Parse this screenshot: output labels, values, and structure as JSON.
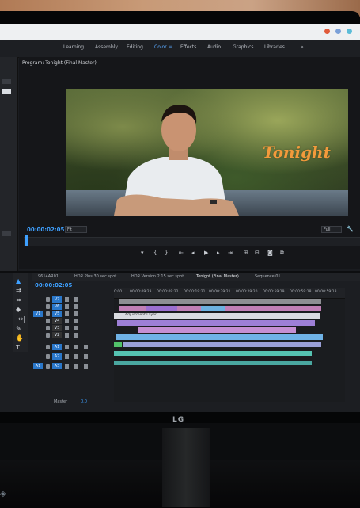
{
  "workspace_tabs": [
    {
      "label": "Learning"
    },
    {
      "label": "Assembly"
    },
    {
      "label": "Editing"
    },
    {
      "label": "Color",
      "active": true
    },
    {
      "label": "Effects"
    },
    {
      "label": "Audio"
    },
    {
      "label": "Graphics"
    },
    {
      "label": "Libraries"
    },
    {
      "label": "»"
    }
  ],
  "program_monitor": {
    "title": "Program: Tonight (Final Master)",
    "overlay_text": "Tonight",
    "timecode": "00:00:02:05",
    "fit_label": "Fit",
    "quality_label": "Full"
  },
  "timeline": {
    "timecode": "00:00:02:05",
    "sequence_tabs": [
      {
        "label": "9614AR01"
      },
      {
        "label": "HDR Plus 30 sec.spot"
      },
      {
        "label": "HDR Version 2 15 sec.spot"
      },
      {
        "label": "Tonight (Final Master)",
        "active": true
      },
      {
        "label": "Sequence 01"
      }
    ],
    "ruler_ticks": [
      "0:00",
      "00:00:09:23",
      "00:00:09:22",
      "00:00:19:21",
      "00:00:39:21",
      "00:00:29:20",
      "00:00:59:19",
      "00:00:59:18",
      "00:00:59:18"
    ],
    "video_tracks": [
      "V7",
      "V6",
      "V5",
      "V4",
      "V3",
      "V2",
      "V1"
    ],
    "audio_tracks": [
      "A1",
      "A2",
      "A3"
    ],
    "adjustment_layer_label": "Adjustment Layer",
    "master_label": "Master",
    "master_value": "0.0"
  },
  "brand": "LG",
  "colors": {
    "accent": "#3ea0ff",
    "title_text": "#f39a3b"
  }
}
